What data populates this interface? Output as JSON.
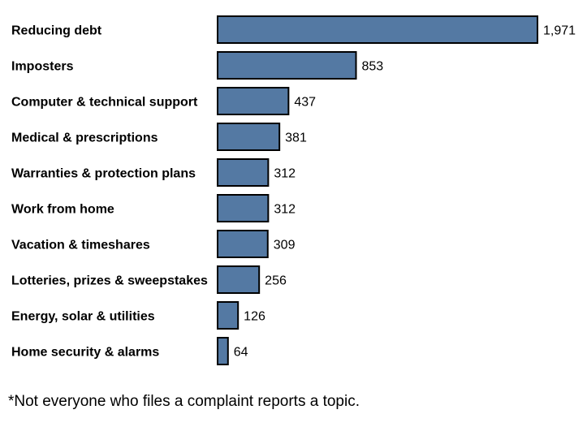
{
  "chart_data": {
    "type": "bar",
    "orientation": "horizontal",
    "title": "",
    "xlabel": "",
    "ylabel": "",
    "categories": [
      "Reducing debt",
      "Imposters",
      "Computer & technical support",
      "Medical & prescriptions",
      "Warranties & protection plans",
      "Work from home",
      "Vacation & timeshares",
      "Lotteries, prizes & sweepstakes",
      "Energy, solar & utilities",
      "Home security & alarms"
    ],
    "values": [
      1971,
      853,
      437,
      381,
      312,
      312,
      309,
      256,
      126,
      64
    ],
    "value_labels": [
      "1,971",
      "853",
      "437",
      "381",
      "312",
      "312",
      "309",
      "256",
      "126",
      "64"
    ],
    "xlim": [
      0,
      1971
    ],
    "grid": false,
    "legend": "none",
    "bar_color": "#5479A3",
    "bar_border_color": "#000000"
  },
  "footnote": "*Not everyone who files a complaint reports a topic."
}
